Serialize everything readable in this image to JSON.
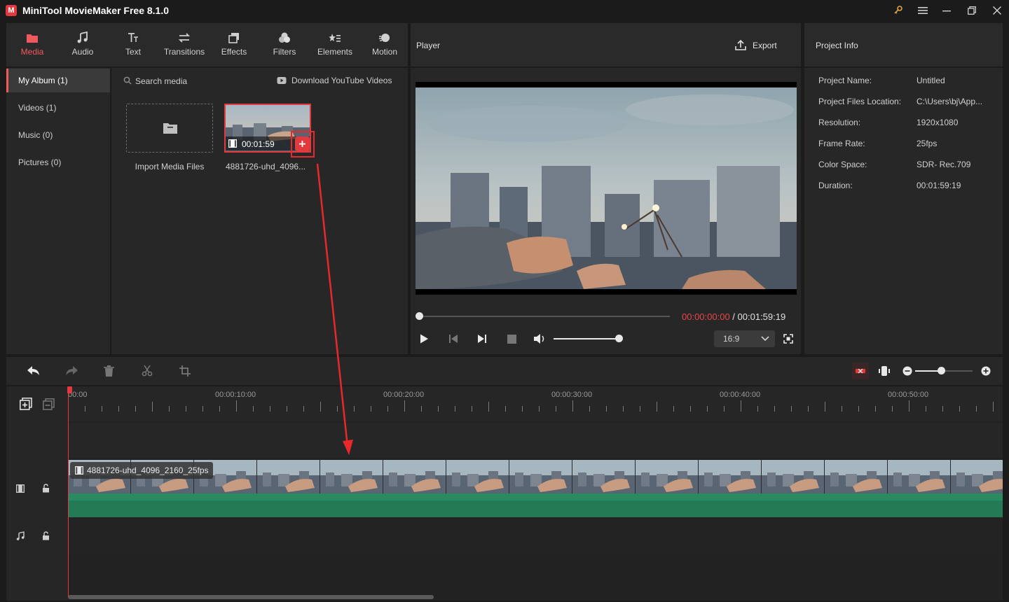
{
  "window": {
    "title": "MiniTool MovieMaker Free 8.1.0",
    "logo_text": "M"
  },
  "toolbar": {
    "tabs": [
      {
        "label": "Media",
        "icon": "media-icon",
        "active": true
      },
      {
        "label": "Audio",
        "icon": "music-note-icon",
        "active": false
      },
      {
        "label": "Text",
        "icon": "text-icon",
        "active": false
      },
      {
        "label": "Transitions",
        "icon": "transitions-icon",
        "active": false
      },
      {
        "label": "Effects",
        "icon": "effects-icon",
        "active": false
      },
      {
        "label": "Filters",
        "icon": "filters-icon",
        "active": false
      },
      {
        "label": "Elements",
        "icon": "elements-icon",
        "active": false
      },
      {
        "label": "Motion",
        "icon": "motion-icon",
        "active": false
      }
    ]
  },
  "sidebar": {
    "items": [
      {
        "label": "My Album (1)",
        "active": true
      },
      {
        "label": "Videos (1)",
        "active": false
      },
      {
        "label": "Music (0)",
        "active": false
      },
      {
        "label": "Pictures (0)",
        "active": false
      }
    ]
  },
  "media": {
    "search_placeholder": "Search media",
    "download_label": "Download YouTube Videos",
    "import_label": "Import Media Files",
    "clip": {
      "name": "4881726-uhd_4096...",
      "duration": "00:01:59"
    }
  },
  "player": {
    "title": "Player",
    "export_label": "Export",
    "current_time": "00:00:00:00",
    "separator": " / ",
    "total_time": "00:01:59:19",
    "aspect_ratio": "16:9",
    "progress": 0,
    "volume": 0.85
  },
  "project_info": {
    "title": "Project Info",
    "rows": [
      {
        "label": "Project Name:",
        "value": "Untitled"
      },
      {
        "label": "Project Files Location:",
        "value": "C:\\Users\\bj\\App..."
      },
      {
        "label": "Resolution:",
        "value": "1920x1080"
      },
      {
        "label": "Frame Rate:",
        "value": "25fps"
      },
      {
        "label": "Color Space:",
        "value": "SDR- Rec.709"
      },
      {
        "label": "Duration:",
        "value": "00:01:59:19"
      }
    ]
  },
  "timeline": {
    "ruler_labels": [
      "00:00",
      "00:00:10:00",
      "00:00:20:00",
      "00:00:30:00",
      "00:00:40:00",
      "00:00:50:00"
    ],
    "clip_label": "4881726-uhd_4096_2160_25fps",
    "zoom_level": 0.45
  },
  "colors": {
    "accent": "#f05a5e",
    "audio_bar": "#2a8a62",
    "arrow": "#e8282c"
  }
}
